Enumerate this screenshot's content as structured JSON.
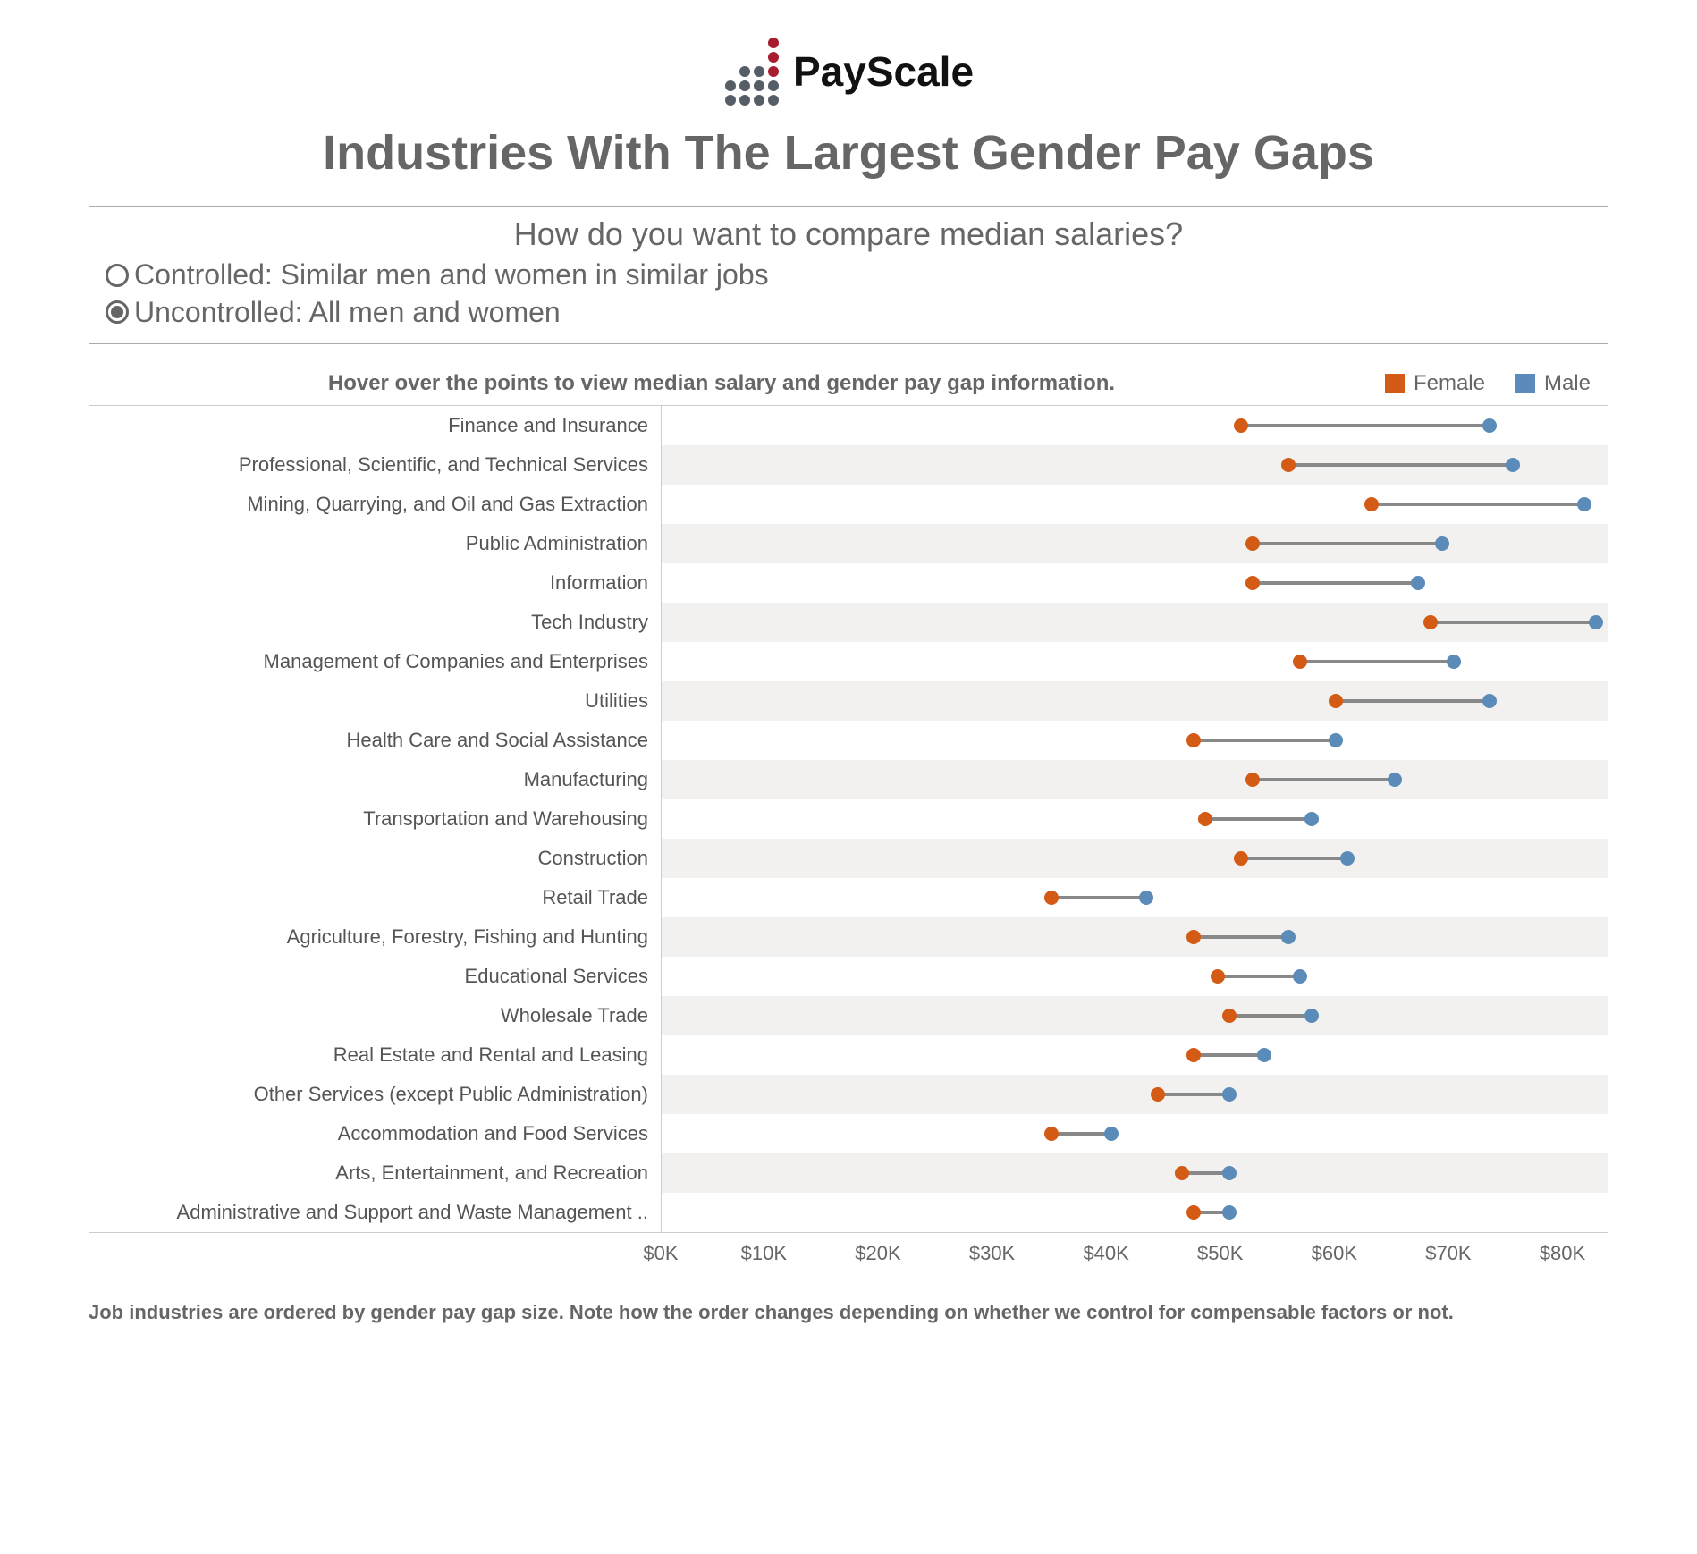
{
  "brand": "PayScale",
  "title": "Industries With The Largest Gender Pay Gaps",
  "options": {
    "prompt": "How do you want to compare median salaries?",
    "controlled_label": "Controlled: Similar men and women in similar jobs",
    "uncontrolled_label": "Uncontrolled: All men and women",
    "selected": "uncontrolled"
  },
  "hover_text": "Hover over the points to view median salary and gender pay gap information.",
  "legend": {
    "female": "Female",
    "male": "Male"
  },
  "axis": {
    "ticks": [
      "$0K",
      "$10K",
      "$20K",
      "$30K",
      "$40K",
      "$50K",
      "$60K",
      "$70K",
      "$80K"
    ],
    "min": 0,
    "max": 80
  },
  "footnote": "Job industries are ordered by gender pay gap size. Note how the order changes depending on whether we control for compensable factors or not.",
  "chart_data": {
    "type": "dot",
    "title": "Industries With The Largest Gender Pay Gaps",
    "xlabel": "",
    "ylabel": "",
    "xlim": [
      0,
      80
    ],
    "x_unit": "$K",
    "series_names": [
      "Female",
      "Male"
    ],
    "rows": [
      {
        "label": "Finance and Insurance",
        "female": 49,
        "male": 70
      },
      {
        "label": "Professional, Scientific, and Technical Services",
        "female": 53,
        "male": 72
      },
      {
        "label": "Mining, Quarrying, and Oil and Gas Extraction",
        "female": 60,
        "male": 78
      },
      {
        "label": "Public Administration",
        "female": 50,
        "male": 66
      },
      {
        "label": "Information",
        "female": 50,
        "male": 64
      },
      {
        "label": "Tech Industry",
        "female": 65,
        "male": 79
      },
      {
        "label": "Management of Companies and Enterprises",
        "female": 54,
        "male": 67
      },
      {
        "label": "Utilities",
        "female": 57,
        "male": 70
      },
      {
        "label": "Health Care and Social Assistance",
        "female": 45,
        "male": 57
      },
      {
        "label": "Manufacturing",
        "female": 50,
        "male": 62
      },
      {
        "label": "Transportation and Warehousing",
        "female": 46,
        "male": 55
      },
      {
        "label": "Construction",
        "female": 49,
        "male": 58
      },
      {
        "label": "Retail Trade",
        "female": 33,
        "male": 41
      },
      {
        "label": "Agriculture, Forestry, Fishing and Hunting",
        "female": 45,
        "male": 53
      },
      {
        "label": "Educational Services",
        "female": 47,
        "male": 54
      },
      {
        "label": "Wholesale Trade",
        "female": 48,
        "male": 55
      },
      {
        "label": "Real Estate and Rental and Leasing",
        "female": 45,
        "male": 51
      },
      {
        "label": "Other Services (except Public Administration)",
        "female": 42,
        "male": 48
      },
      {
        "label": "Accommodation and Food Services",
        "female": 33,
        "male": 38
      },
      {
        "label": "Arts, Entertainment, and Recreation",
        "female": 44,
        "male": 48
      },
      {
        "label": "Administrative and Support and Waste Management ..",
        "female": 45,
        "male": 48
      }
    ]
  }
}
